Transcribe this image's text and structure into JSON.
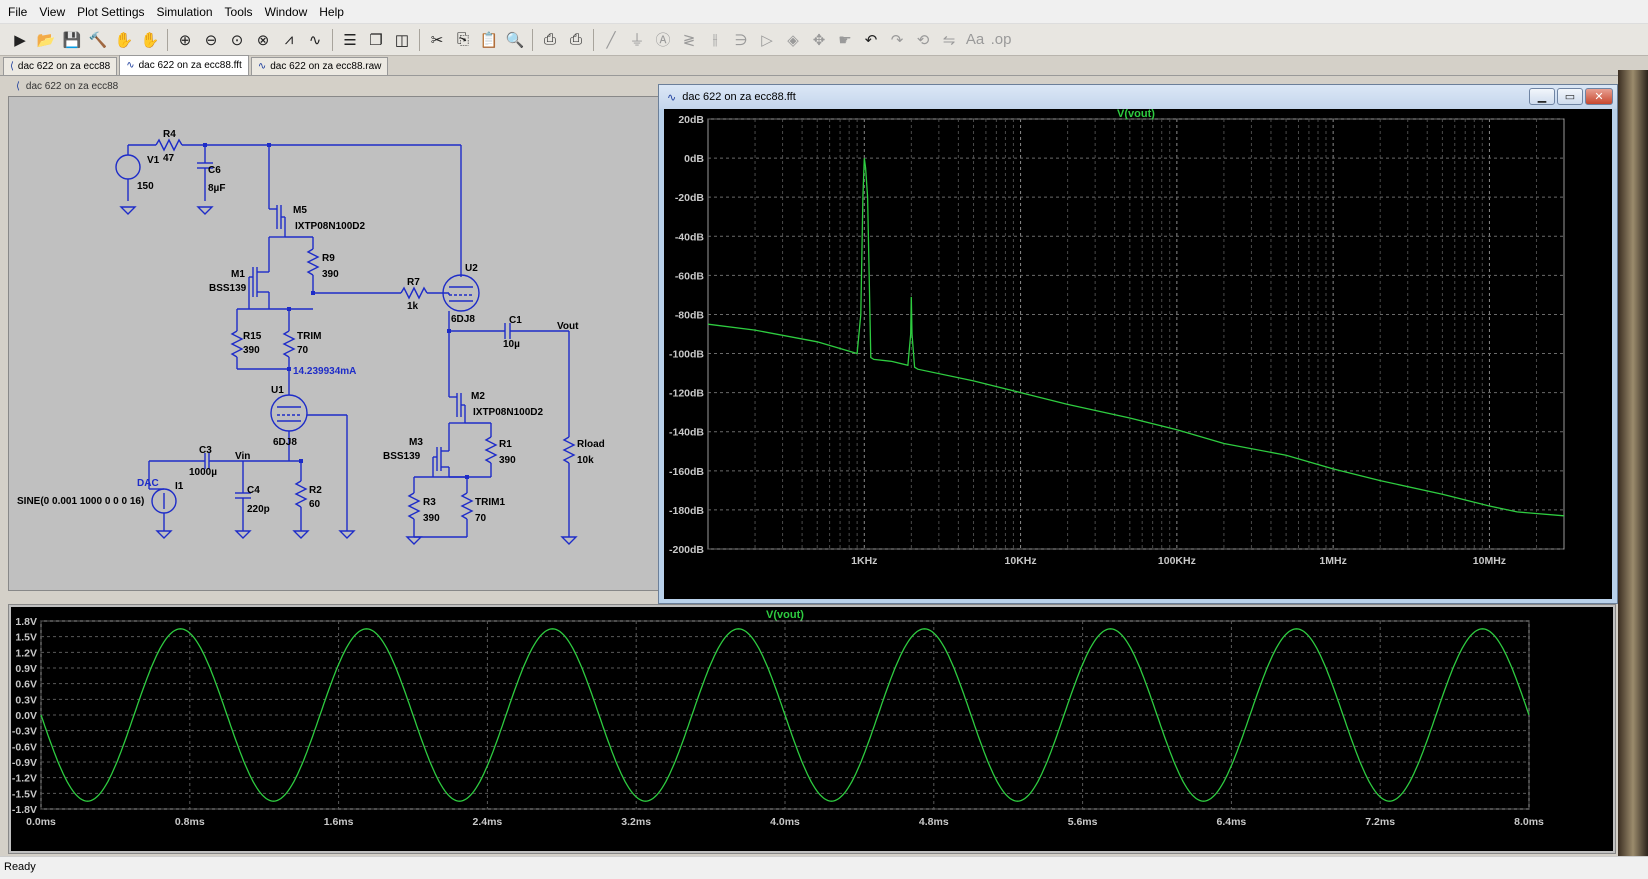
{
  "menubar": [
    "File",
    "View",
    "Plot Settings",
    "Simulation",
    "Tools",
    "Window",
    "Help"
  ],
  "toolbar": [
    "run-icon",
    "open-icon",
    "save-icon",
    "control-panel-icon",
    "halt-icon",
    "pan-icon",
    "zoom-in-icon",
    "zoom-out-icon",
    "zoom-fit-icon",
    "zoom-cancel-icon",
    "autorange-icon",
    "waveform-icon",
    "tile-horizontal-icon",
    "cascade-icon",
    "tile-vertical-icon",
    "cut-icon",
    "copy-icon",
    "paste-icon",
    "find-icon",
    "print-preview-icon",
    "print-icon",
    "wire-icon",
    "ground-icon",
    "label-icon",
    "resistor-icon",
    "capacitor-icon",
    "inductor-icon",
    "diode-icon",
    "component-icon",
    "move-icon",
    "drag-icon",
    "undo-icon",
    "redo-icon",
    "rotate-icon",
    "mirror-icon",
    "text-icon",
    "spice-directive-icon"
  ],
  "tabs": [
    {
      "label": "dac 622 on za ecc88",
      "icon": "schematic-icon"
    },
    {
      "label": "dac 622 on za ecc88.fft",
      "icon": "waveform-icon"
    },
    {
      "label": "dac 622 on za ecc88.raw",
      "icon": "waveform-icon"
    }
  ],
  "schematic": {
    "title": "dac 622 on za ecc88",
    "labels": {
      "V1": "V1",
      "V1val": "150",
      "R4": "R4",
      "R4val": "47",
      "C6": "C6",
      "C6val": "8µF",
      "M5": "M5",
      "M5val": "IXTP08N100D2",
      "R9": "R9",
      "R9val": "390",
      "M1": "M1",
      "M1val": "BSS139",
      "R7": "R7",
      "R7val": "1k",
      "U2": "U2",
      "U2val": "6DJ8",
      "R15": "R15",
      "R15val": "390",
      "TRIM": "TRIM",
      "TRIMval": "70",
      "current": "14.239934mA",
      "C1": "C1",
      "C1val": "10µ",
      "Vout": "Vout",
      "U1": "U1",
      "U1val": "6DJ8",
      "M2": "M2",
      "M2val": "IXTP08N100D2",
      "R1": "R1",
      "R1val": "390",
      "M3": "M3",
      "M3val": "BSS139",
      "C3": "C3",
      "C3val": "1000µ",
      "Vin": "Vin",
      "DAC": "DAC",
      "I1": "I1",
      "I1val": "SINE(0 0.001 1000 0 0 0 16)",
      "C4": "C4",
      "C4val": "220p",
      "R2": "R2",
      "R2val": "60",
      "Rload": "Rload",
      "Rloadval": "10k",
      "R3": "R3",
      "R3val": "390",
      "TRIM1": "TRIM1",
      "TRIM1val": "70"
    }
  },
  "fft_window": {
    "title": "dac 622 on za ecc88.fft",
    "controls": {
      "minimize": "▁",
      "maximize": "▭",
      "close": "✕"
    }
  },
  "transient_window": {
    "title_fragment": "dac 622 on za ecc88.raw"
  },
  "status": "Ready",
  "chart_data": [
    {
      "type": "line",
      "title": "V(vout)",
      "x_scale": "log",
      "x_ticks": [
        "1KHz",
        "10KHz",
        "100KHz",
        "1MHz",
        "10MHz"
      ],
      "y_ticks": [
        "20dB",
        "0dB",
        "-20dB",
        "-40dB",
        "-60dB",
        "-80dB",
        "-100dB",
        "-120dB",
        "-140dB",
        "-160dB",
        "-180dB",
        "-200dB"
      ],
      "ylim": [
        -200,
        20
      ],
      "xlim": [
        100,
        30000000
      ],
      "grid": true,
      "series_color": "#2ecc40",
      "series": [
        {
          "name": "V(vout)",
          "x": [
            100,
            200,
            500,
            900,
            950,
            980,
            1000,
            1020,
            1050,
            1100,
            1150,
            1500,
            1900,
            1980,
            2000,
            2020,
            2100,
            2200,
            5000,
            10000,
            20000,
            50000,
            100000,
            200000,
            500000,
            1000000,
            2000000,
            5000000,
            10000000,
            15000000,
            30000000
          ],
          "y": [
            -85,
            -88,
            -94,
            -100,
            -80,
            -20,
            0,
            -5,
            -20,
            -102,
            -103,
            -104,
            -106,
            -90,
            -71,
            -90,
            -107,
            -108,
            -114,
            -120,
            -126,
            -133,
            -139,
            -146,
            -152,
            -159,
            -165,
            -172,
            -178,
            -181,
            -183
          ]
        }
      ]
    },
    {
      "type": "line",
      "title": "V(vout)",
      "x_ticks": [
        "0.0ms",
        "0.8ms",
        "1.6ms",
        "2.4ms",
        "3.2ms",
        "4.0ms",
        "4.8ms",
        "5.6ms",
        "6.4ms",
        "7.2ms",
        "8.0ms"
      ],
      "y_ticks": [
        "1.8V",
        "1.5V",
        "1.2V",
        "0.9V",
        "0.6V",
        "0.3V",
        "0.0V",
        "-0.3V",
        "-0.6V",
        "-0.9V",
        "-1.2V",
        "-1.5V",
        "-1.8V"
      ],
      "ylim": [
        -1.8,
        1.8
      ],
      "xlim": [
        0,
        8.0
      ],
      "grid": true,
      "series_color": "#2ecc40",
      "series": [
        {
          "name": "V(vout)",
          "waveform": "sine",
          "amplitude": 1.65,
          "frequency_khz": 1.0,
          "phase": "inverted"
        }
      ]
    }
  ]
}
